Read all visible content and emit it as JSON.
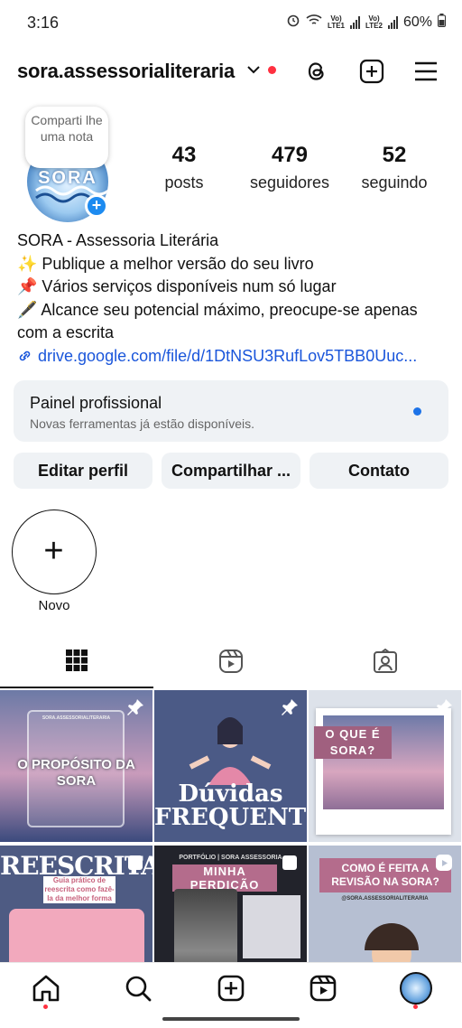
{
  "status": {
    "time": "3:16",
    "lte1": "Vo)\nLTE1",
    "lte2": "Vo)\nLTE2",
    "battery": "60%"
  },
  "header": {
    "username": "sora.assessorialiteraria"
  },
  "profile": {
    "note_text": "Comparti lhe uma nota",
    "avatar_logo": "SORA",
    "posts_count": "43",
    "posts_label": "posts",
    "followers_count": "479",
    "followers_label": "seguidores",
    "following_count": "52",
    "following_label": "seguindo"
  },
  "bio": {
    "name": "SORA - Assessoria Literária",
    "line1": "✨ Publique a melhor versão do seu livro",
    "line2": "📌 Vários serviços disponíveis num só lugar",
    "line3": "🖋️ Alcance seu potencial máximo, preocupe-se apenas com a escrita",
    "link": "drive.google.com/file/d/1DtNSU3RufLov5TBB0Uuc..."
  },
  "panel": {
    "title": "Painel profissional",
    "subtitle": "Novas ferramentas já estão disponíveis."
  },
  "buttons": {
    "edit": "Editar perfil",
    "share": "Compartilhar ...",
    "contact": "Contato"
  },
  "highlight": {
    "new_label": "Novo"
  },
  "posts": [
    {
      "text": "O PROPÓSITO DA SORA",
      "small": "SORA.ASSESSORIALITERARIA"
    },
    {
      "text": "Dúvidas FREQUENTES",
      "small": ""
    },
    {
      "text": "O QUE É SORA?",
      "small": ""
    },
    {
      "text": "REESCRITA",
      "small": "Guia prático de reescrita como fazê-la da melhor forma"
    },
    {
      "text": "MINHA PERDIÇÃO",
      "small": "PORTFÓLIO | SORA ASSESSORIA"
    },
    {
      "text": "COMO É FEITA A REVISÃO NA SORA?",
      "small": "@SORA.ASSESSORIALITERARIA"
    }
  ],
  "colors": {
    "accent": "#1d8bf0",
    "link": "#1a56db",
    "notification": "#ff3040",
    "panel_bg": "#eff2f5"
  }
}
